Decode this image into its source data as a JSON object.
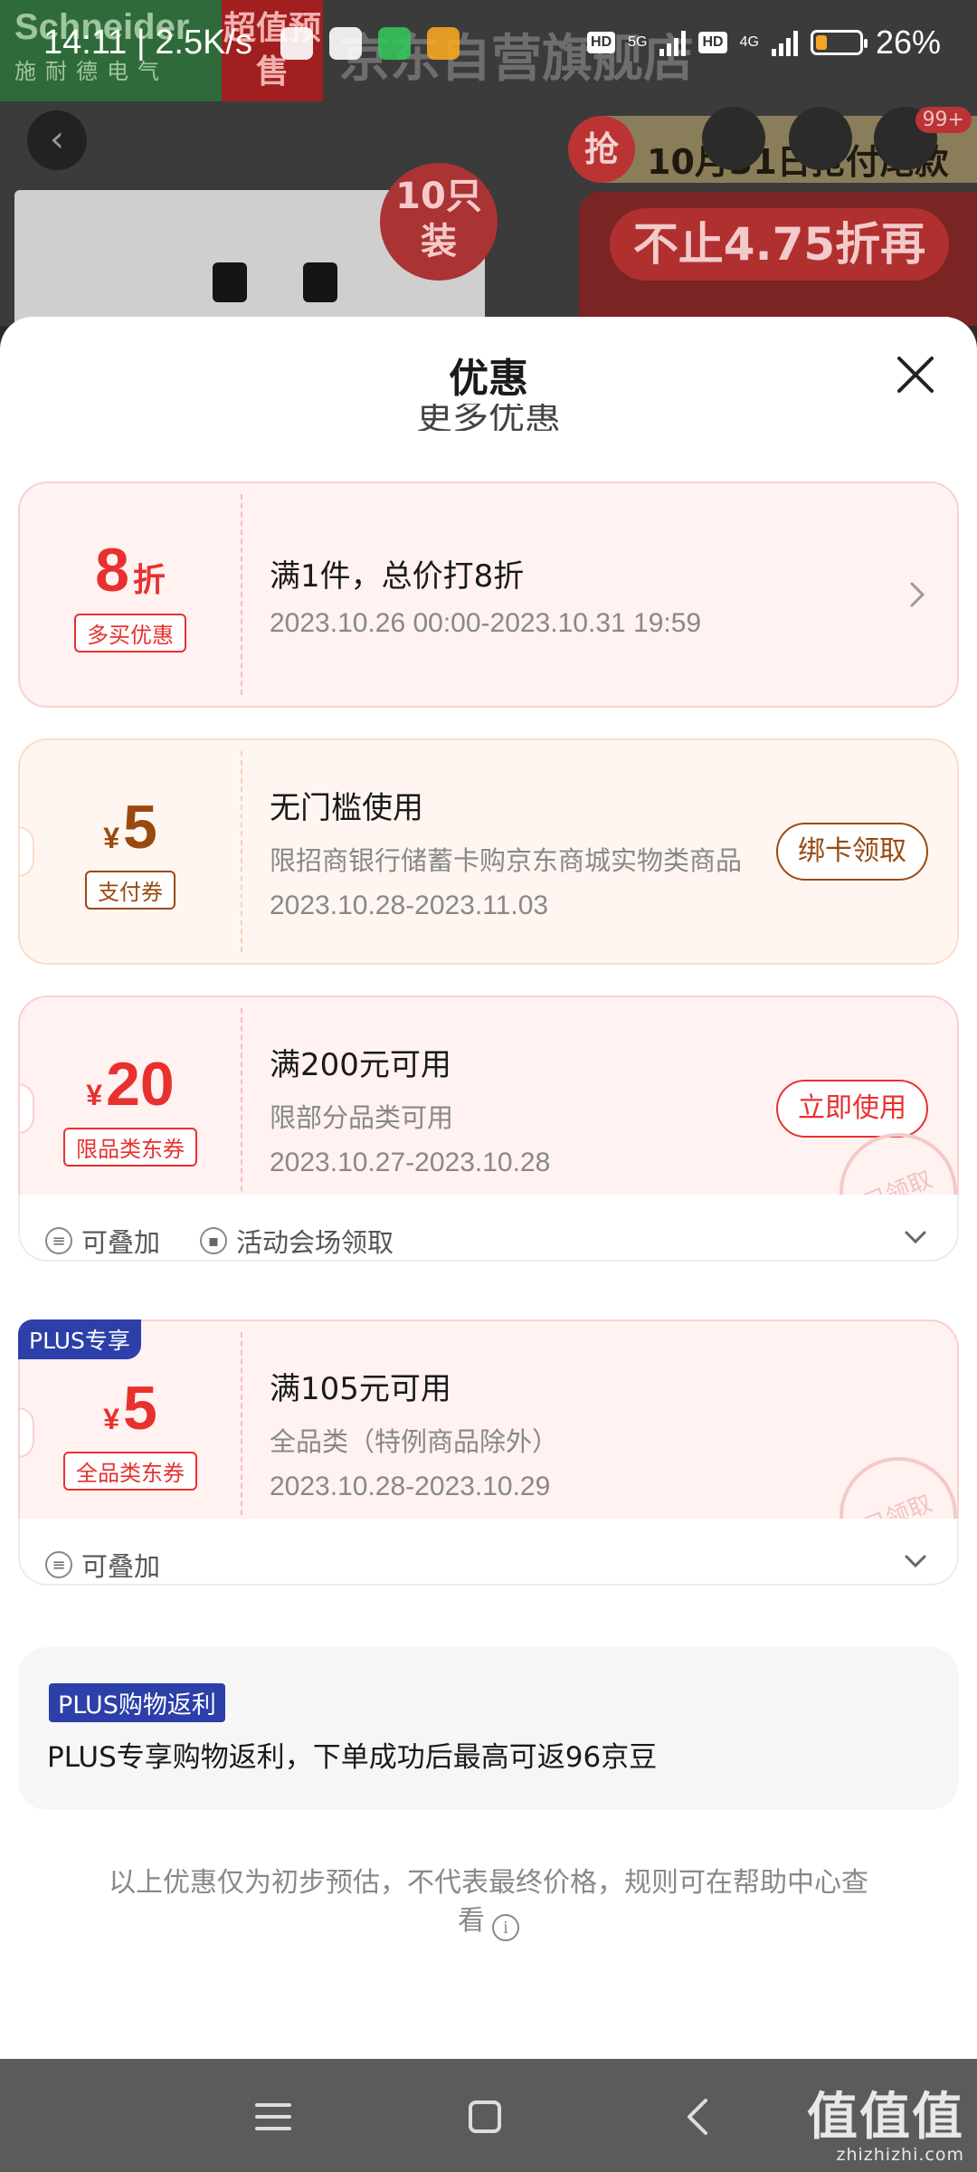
{
  "status_bar": {
    "time": "14:11 | 2.5K/s",
    "battery": "26%",
    "battery_level": 0.26,
    "net1": "5G",
    "net2": "4G",
    "hd": "HD"
  },
  "background": {
    "brand": "Schneider",
    "brand_cn": "施耐德电气",
    "presale": "超值预售",
    "store_name": "京东自营旗舰店",
    "grab_badge": "抢",
    "promo_banner": "10月31日抢付尾款",
    "promo_sub": "不止4.75折再",
    "pack_label": "10只装",
    "cart_badge": "99+"
  },
  "sheet": {
    "title": "优惠",
    "partial_heading": "更多优惠"
  },
  "coupons": [
    {
      "amount": "8",
      "unit": "折",
      "tag": "多买优惠",
      "title": "满1件，总价打8折",
      "desc": "",
      "dates": "2023.10.26 00:00-2023.10.31 19:59"
    },
    {
      "currency": "¥",
      "amount": "5",
      "tag": "支付券",
      "title": "无门槛使用",
      "desc": "限招商银行储蓄卡购京东商城实物类商品",
      "dates": "2023.10.28-2023.11.03",
      "button": "绑卡领取"
    },
    {
      "currency": "¥",
      "amount": "20",
      "tag": "限品类东券",
      "title": "满200元可用",
      "desc": "限部分品类可用",
      "dates": "2023.10.27-2023.10.28",
      "button": "立即使用",
      "stamp": "已领取",
      "footer": {
        "stackable": "可叠加",
        "source": "活动会场领取"
      }
    },
    {
      "badge": "PLUS专享",
      "currency": "¥",
      "amount": "5",
      "tag": "全品类东券",
      "title": "满105元可用",
      "desc": "全品类（特例商品除外）",
      "dates": "2023.10.28-2023.10.29",
      "stamp": "已领取",
      "footer": {
        "stackable": "可叠加"
      }
    }
  ],
  "rebate": {
    "tag": "PLUS购物返利",
    "text": "PLUS专享购物返利，下单成功后最高可返96京豆"
  },
  "disclaimer": "以上优惠仅为初步预估，不代表最终价格，规则可在帮助中心查看",
  "watermark": {
    "cn": "值值值",
    "url": "zhizhizhi.com"
  },
  "colors": {
    "accent_red": "#e8312f",
    "pay_brown": "#9a4a10",
    "plus_blue": "#2d3fa8"
  }
}
